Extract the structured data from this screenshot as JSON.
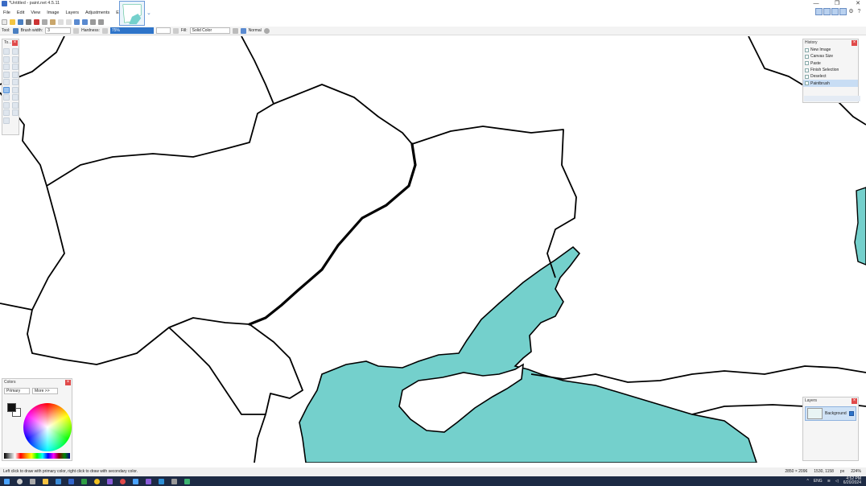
{
  "window": {
    "title": "*Untitled - paint.net 4.5.11",
    "controls": [
      "—",
      "❐",
      "✕"
    ]
  },
  "menu": [
    "File",
    "Edit",
    "View",
    "Image",
    "Layers",
    "Adjustments",
    "Effects"
  ],
  "toolbar": {
    "tool_label": "Tool:",
    "brush_width_label": "Brush width:",
    "brush_width_value": "3",
    "hardness_label": "Hardness:",
    "hardness_value": "75%",
    "fill_label": "Fill:",
    "fill_value": "Solid Color",
    "blend_value": "Normal"
  },
  "panels": {
    "tools": {
      "title": "To..."
    },
    "history": {
      "title": "History",
      "items": [
        "New Image",
        "Canvas Size",
        "Paste",
        "Finish Selection",
        "Deselect",
        "Paintbrush"
      ]
    },
    "colors": {
      "title": "Colors",
      "mode_value": "Primary",
      "more_label": "More >>"
    },
    "layers": {
      "title": "Layers",
      "layer_name": "Background"
    }
  },
  "status": {
    "hint": "Left click to draw with primary color, right click to draw with secondary color.",
    "image_size": "2850 × 2096",
    "cursor_pos": "1530, 1158",
    "unit": "px",
    "zoom": "224%"
  },
  "taskbar": {
    "lang": "ENG",
    "time": "4:52 PM",
    "date": "6/20/2024"
  },
  "colors": {
    "sea": "#74d0cc",
    "accent": "#2e74c9",
    "border": "#000000"
  }
}
